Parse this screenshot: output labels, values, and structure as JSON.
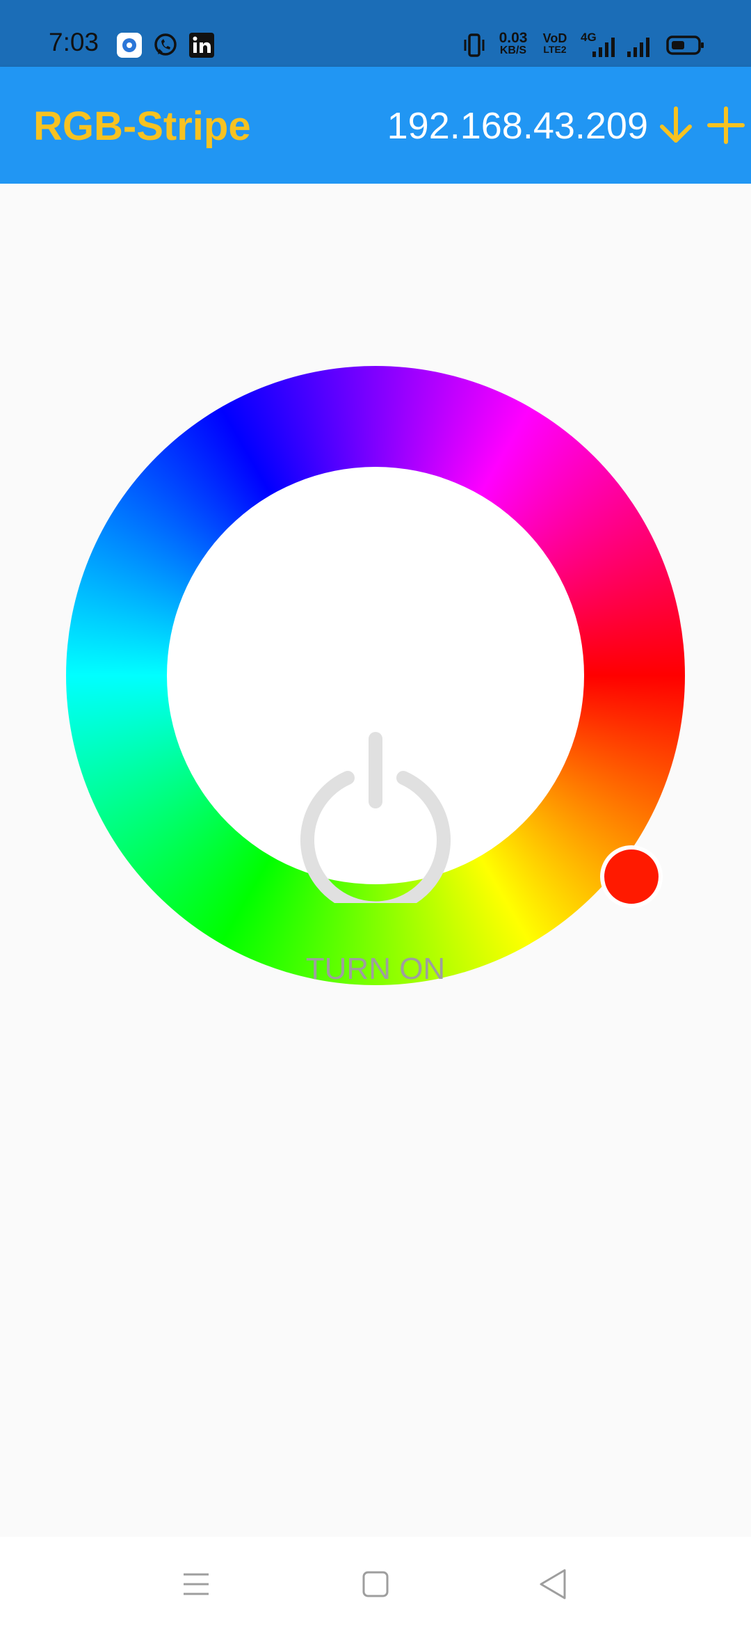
{
  "status_bar": {
    "time": "7:03",
    "data_rate_value": "0.03",
    "data_rate_unit": "KB/S",
    "volte_top": "VoD",
    "volte_bottom": "LTE2",
    "network_type": "4G",
    "icons": [
      "signal-app-icon",
      "whatsapp-icon",
      "linkedin-icon",
      "vibrate-icon",
      "signal-strength-icon",
      "battery-icon"
    ]
  },
  "app_bar": {
    "title": "RGB-Stripe",
    "ip_address": "192.168.43.209",
    "icons": [
      "arrow-down-icon",
      "plus-icon"
    ],
    "accent_color": "#f7c221",
    "background_color": "#2196f3"
  },
  "color_wheel": {
    "power_label": "TURN ON",
    "selected_color": "#ff1a00"
  },
  "nav_bar": {
    "icons": [
      "menu-icon",
      "home-icon",
      "back-icon"
    ]
  }
}
